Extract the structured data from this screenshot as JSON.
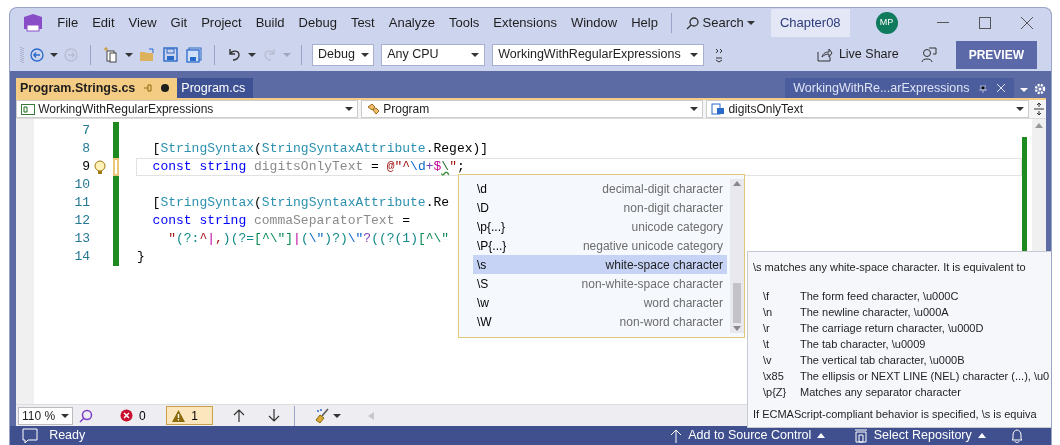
{
  "title_bar": {
    "menu": [
      "File",
      "Edit",
      "View",
      "Git",
      "Project",
      "Build",
      "Debug",
      "Test",
      "Analyze",
      "Tools",
      "Extensions",
      "Window",
      "Help"
    ],
    "search": "Search",
    "solution": "Chapter08",
    "avatar": "MP"
  },
  "toolbar": {
    "configuration": "Debug",
    "platform": "Any CPU",
    "startup_project": "WorkingWithRegularExpressions",
    "live_share": "Live Share",
    "preview": "PREVIEW"
  },
  "tabs": [
    {
      "label": "Program.Strings.cs",
      "selected": true,
      "modified": true
    },
    {
      "label": "Program.cs",
      "selected": false,
      "modified": false
    }
  ],
  "tool_window_tab": {
    "label": "WorkingWithRe...arExpressions"
  },
  "nav_bar": {
    "project": "WorkingWithRegularExpressions",
    "type": "Program",
    "member": "digitsOnlyText"
  },
  "code_lines": [
    {
      "number": "7",
      "current": false,
      "lightbulb": false,
      "unsaved": false
    },
    {
      "number": "8",
      "current": false,
      "lightbulb": false,
      "unsaved": false,
      "tokens": [
        {
          "text": "  [",
          "kind": "plain"
        },
        {
          "text": "StringSyntax",
          "kind": "type"
        },
        {
          "text": "(",
          "kind": "plain"
        },
        {
          "text": "StringSyntaxAttribute",
          "kind": "type"
        },
        {
          "text": ".Regex)]",
          "kind": "plain"
        }
      ]
    },
    {
      "number": "9",
      "current": true,
      "lightbulb": true,
      "unsaved": true,
      "tokens": [
        {
          "text": "  const",
          "kind": "keyword"
        },
        {
          "text": " string",
          "kind": "keyword"
        },
        {
          "text": " digitsOnlyText",
          "kind": "unused"
        },
        {
          "text": " = ",
          "kind": "plain"
        },
        {
          "text": "@\"",
          "kind": "string"
        },
        {
          "text": "^",
          "kind": "anchor"
        },
        {
          "text": "\\d",
          "kind": "escape"
        },
        {
          "text": "+",
          "kind": "quantifier"
        },
        {
          "text": "$",
          "kind": "alternation"
        },
        {
          "text": "\\",
          "kind": "error"
        },
        {
          "text": "\"",
          "kind": "string"
        },
        {
          "text": ";",
          "kind": "plain"
        }
      ]
    },
    {
      "number": "10",
      "current": false,
      "lightbulb": false,
      "unsaved": false
    },
    {
      "number": "11",
      "current": false,
      "lightbulb": false,
      "unsaved": false,
      "tokens": [
        {
          "text": "  [",
          "kind": "plain"
        },
        {
          "text": "StringSyntax",
          "kind": "type"
        },
        {
          "text": "(",
          "kind": "plain"
        },
        {
          "text": "StringSyntaxAttribute",
          "kind": "type"
        },
        {
          "text": ".Re",
          "kind": "plain"
        }
      ]
    },
    {
      "number": "12",
      "current": false,
      "lightbulb": false,
      "unsaved": false,
      "tokens": [
        {
          "text": "  const",
          "kind": "keyword"
        },
        {
          "text": " string",
          "kind": "keyword"
        },
        {
          "text": " commaSeparatorText",
          "kind": "unused"
        },
        {
          "text": " =",
          "kind": "plain"
        }
      ]
    },
    {
      "number": "13",
      "current": false,
      "lightbulb": false,
      "unsaved": false,
      "tokens": [
        {
          "text": "    \"",
          "kind": "string"
        },
        {
          "text": "(?:",
          "kind": "group"
        },
        {
          "text": "^",
          "kind": "anchor"
        },
        {
          "text": "|",
          "kind": "alternation"
        },
        {
          "text": ",",
          "kind": "string"
        },
        {
          "text": ")(?=",
          "kind": "group"
        },
        {
          "text": "[^\\\"]",
          "kind": "class"
        },
        {
          "text": "|",
          "kind": "alternation"
        },
        {
          "text": "(",
          "kind": "group"
        },
        {
          "text": "\\\"",
          "kind": "escape"
        },
        {
          "text": ")?)",
          "kind": "group"
        },
        {
          "text": "\\\"",
          "kind": "escape"
        },
        {
          "text": "?",
          "kind": "quantifier"
        },
        {
          "text": "((?(1)",
          "kind": "group"
        },
        {
          "text": "[^\\\"",
          "kind": "class"
        }
      ]
    },
    {
      "number": "14",
      "current": false,
      "lightbulb": false,
      "unsaved": false,
      "tokens": [
        {
          "text": "}",
          "kind": "plain"
        }
      ]
    }
  ],
  "completion": {
    "items": [
      {
        "label": "\\d",
        "description": "decimal-digit character",
        "selected": false
      },
      {
        "label": "\\D",
        "description": "non-digit character",
        "selected": false
      },
      {
        "label": "\\p{...}",
        "description": "unicode category",
        "selected": false
      },
      {
        "label": "\\P{...}",
        "description": "negative unicode category",
        "selected": false
      },
      {
        "label": "\\s",
        "description": "white-space character",
        "selected": true
      },
      {
        "label": "\\S",
        "description": "non-white-space character",
        "selected": false
      },
      {
        "label": "\\w",
        "description": "word character",
        "selected": false
      },
      {
        "label": "\\W",
        "description": "non-word character",
        "selected": false
      }
    ]
  },
  "quick_info": {
    "summary": "\\s matches any white-space character. It is equivalent to",
    "entries": [
      {
        "code": "\\f",
        "text": "The form feed character, \\u000C"
      },
      {
        "code": "\\n",
        "text": "The newline character, \\u000A"
      },
      {
        "code": "\\r",
        "text": "The carriage return character, \\u000D"
      },
      {
        "code": "\\t",
        "text": "The tab character, \\u0009"
      },
      {
        "code": "\\v",
        "text": "The vertical tab character, \\u000B"
      },
      {
        "code": "\\x85",
        "text": "The ellipsis or NEXT LINE (NEL) character (...), \\u0"
      },
      {
        "code": "\\p{Z}",
        "text": "Matches any separator character"
      }
    ],
    "footer": "If ECMAScript-compliant behavior is specified, \\s is equiva"
  },
  "editor_status": {
    "zoom": "110 %",
    "errors": "0",
    "warnings": "1"
  },
  "status_bar": {
    "message": "Ready",
    "source_control": "Add to Source Control",
    "repository": "Select Repository"
  }
}
